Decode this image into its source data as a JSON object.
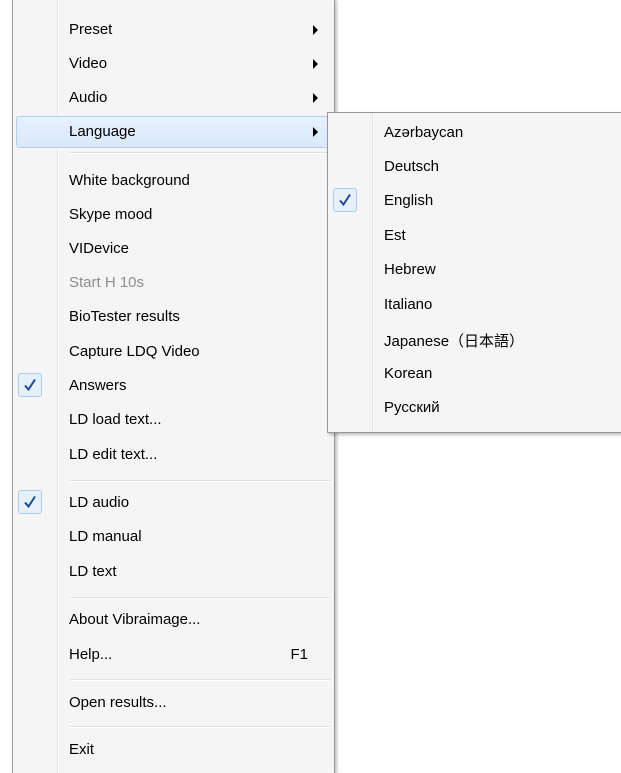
{
  "main_menu": {
    "preset": "Preset",
    "video": "Video",
    "audio": "Audio",
    "language": "Language",
    "white_background": "White background",
    "skype_mood": "Skype mood",
    "videvice": "VIDevice",
    "start_h": "Start H 10s",
    "biotester_results": "BioTester results",
    "capture_ldq_video": "Capture LDQ Video",
    "answers": "Answers",
    "ld_load_text": "LD load text...",
    "ld_edit_text": "LD edit text...",
    "ld_audio": "LD audio",
    "ld_manual": "LD manual",
    "ld_text": "LD text",
    "about": "About Vibraimage...",
    "help": "Help...",
    "help_shortcut": "F1",
    "open_results": "Open results...",
    "exit": "Exit"
  },
  "language_submenu": {
    "items": [
      "Azərbaycan",
      "Deutsch",
      "English",
      "Est",
      "Hebrew",
      "Italiano",
      "Japanese（日本語）",
      "Korean",
      "Русский"
    ],
    "checked": "English"
  },
  "colors": {
    "menu_bg": "#f5f5f5",
    "highlight": "#d9e8fb",
    "check_accent": "#1a4a9c",
    "disabled_text": "#8d8d8d"
  }
}
